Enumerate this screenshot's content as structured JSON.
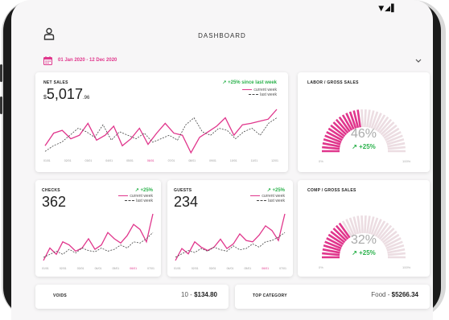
{
  "status": {
    "icons": "▼◢▌"
  },
  "header": {
    "title": "DASHBOARD"
  },
  "date_range": {
    "label": "01 Jan 2020 - 12 Dec 2020"
  },
  "colors": {
    "accent": "#e0368c",
    "positive": "#2bb24c",
    "last_week": "#444444",
    "gauge_empty": "#ecdde2"
  },
  "net_sales": {
    "title": "NET SALES",
    "dollar": "$",
    "value": "5,017",
    "cents": ".96",
    "delta": "↗ +25% since last week",
    "legend_current": "current week",
    "legend_last": "last week",
    "x_ticks": [
      "01/01",
      "02/01",
      "03/01",
      "04/01",
      "05/01",
      "06/01",
      "07/01",
      "08/01",
      "09/01",
      "10/01",
      "11/01",
      "12/01"
    ],
    "highlight_tick": "06/01"
  },
  "checks": {
    "title": "CHECKS",
    "value": "362",
    "delta": "↗ +25%",
    "legend_current": "current week",
    "legend_last": "last week",
    "x_ticks": [
      "01/01",
      "02/01",
      "03/01",
      "04/01",
      "05/01",
      "06/01",
      "07/01"
    ],
    "highlight_tick": "06/01"
  },
  "guests": {
    "title": "GUESTS",
    "value": "234",
    "delta": "↗ +25%",
    "legend_current": "current week",
    "legend_last": "last week",
    "x_ticks": [
      "01/01",
      "02/01",
      "03/01",
      "04/01",
      "05/01",
      "06/01",
      "07/01"
    ],
    "highlight_tick": "06/01"
  },
  "labor": {
    "title": "LABOR / GROSS SALES",
    "percent": "46%",
    "delta": "↗ +25%",
    "low": "0%",
    "high": "100%",
    "level": 0.46
  },
  "comp": {
    "title": "COMP / GROSS SALES",
    "percent": "32%",
    "delta": "↗ +25%",
    "low": "0%",
    "high": "100%",
    "level": 0.32
  },
  "voids": {
    "label": "VOIDS",
    "count": "10 -",
    "amount": "$134.80"
  },
  "top_category": {
    "label": "TOP CATEGORY",
    "name": "Food -",
    "amount": "$5266.34"
  },
  "chart_data": [
    {
      "type": "line",
      "title": "NET SALES",
      "x": [
        "01/01",
        "02/01",
        "03/01",
        "04/01",
        "05/01",
        "06/01",
        "07/01",
        "08/01",
        "09/01",
        "10/01",
        "11/01",
        "12/01"
      ],
      "series": [
        {
          "name": "current week",
          "values": [
            30,
            48,
            52,
            40,
            45,
            62,
            38,
            45,
            58,
            30,
            40,
            55,
            32,
            48,
            62,
            48,
            45,
            20,
            42,
            50,
            58,
            70,
            45,
            60,
            62,
            65,
            68,
            82
          ]
        },
        {
          "name": "last week",
          "values": [
            22,
            30,
            35,
            45,
            55,
            50,
            42,
            60,
            38,
            50,
            45,
            40,
            48,
            35,
            40,
            45,
            38,
            60,
            70,
            50,
            45,
            55,
            52,
            40,
            50,
            55,
            45,
            62,
            70
          ]
        }
      ]
    },
    {
      "type": "line",
      "title": "CHECKS",
      "x": [
        "01/01",
        "02/01",
        "03/01",
        "04/01",
        "05/01",
        "06/01",
        "07/01"
      ],
      "series": [
        {
          "name": "current week",
          "values": [
            10,
            30,
            20,
            40,
            35,
            25,
            30,
            45,
            28,
            35,
            55,
            45,
            38,
            50,
            68,
            60,
            40,
            85
          ]
        },
        {
          "name": "last week",
          "values": [
            15,
            20,
            25,
            20,
            28,
            22,
            30,
            26,
            24,
            30,
            25,
            28,
            35,
            30,
            40,
            38,
            45,
            55
          ]
        }
      ]
    },
    {
      "type": "line",
      "title": "GUESTS",
      "x": [
        "01/01",
        "02/01",
        "03/01",
        "04/01",
        "05/01",
        "06/01",
        "07/01"
      ],
      "series": [
        {
          "name": "current week",
          "values": [
            10,
            28,
            20,
            38,
            30,
            25,
            30,
            42,
            28,
            35,
            50,
            40,
            38,
            48,
            62,
            55,
            40,
            80
          ]
        },
        {
          "name": "last week",
          "values": [
            15,
            20,
            25,
            22,
            28,
            24,
            30,
            26,
            24,
            32,
            26,
            28,
            35,
            30,
            38,
            40,
            45,
            52
          ]
        }
      ]
    }
  ]
}
